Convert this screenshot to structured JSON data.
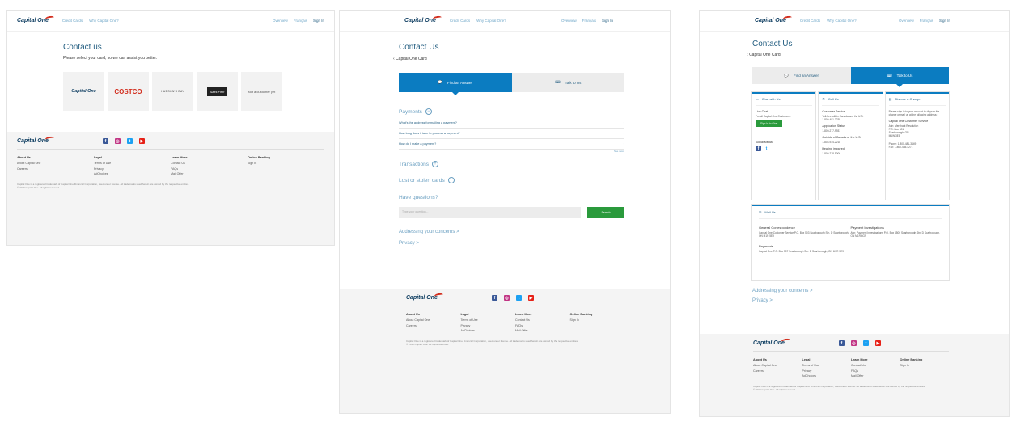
{
  "brand": {
    "logo_text": "Capital One",
    "accent": "#0b7cc1",
    "green": "#2a9a3c"
  },
  "header": {
    "nav": [
      "Credit Cards",
      "Why Capital One?"
    ],
    "right": [
      "Overview",
      "Français",
      "Sign In"
    ]
  },
  "screen1": {
    "title": "Contact us",
    "subtitle": "Please select your card, so we can assist you better.",
    "cards": [
      "Capital One",
      "COSTCO",
      "HUDSON'S BAY",
      "Saks Fifth",
      "Not a customer yet"
    ]
  },
  "screen2": {
    "title": "Contact Us",
    "back": "Capital One Card",
    "tabs": [
      "Find an Answer",
      "Talk to Us"
    ],
    "payments_heading": "Payments",
    "questions": [
      "What's the address for mailing a payment?",
      "How long does it take to process a payment?",
      "How do I make a payment?"
    ],
    "see_more": "See more",
    "transactions": "Transactions",
    "lost": "Lost or stolen cards",
    "have_questions": "Have questions?",
    "search_placeholder": "Type your question...",
    "search_button": "Search",
    "addressing": "Addressing your concerns >",
    "privacy": "Privacy >"
  },
  "screen3": {
    "title": "Contact Us",
    "back": "Capital One Card",
    "tabs": [
      "Find an Answer",
      "Talk to Us"
    ],
    "chat": {
      "head": "Chat with Us",
      "live": "Live Chat",
      "line1": "For all Capital One Customers:",
      "btn": "Sign In to Chat",
      "social": "Social Media"
    },
    "call": {
      "head": "Call Us",
      "cs": "Customer Service",
      "cs_sub": "Toll-free within Canada and the U.S.",
      "cs_num": "1-800-481-3239",
      "app": "Application Status",
      "app_num": "1-800-277-9931",
      "out": "Outside of Canada or the U.S.",
      "out_num": "1-804-934-2218",
      "hear": "Hearing impaired",
      "hear_num": "1-800-278-5006"
    },
    "dispute": {
      "head": "Dispute a Charge",
      "line": "Please sign in to your account to dispute the charge or mail us at the following address:",
      "org": "Capital One Customer Service",
      "addr": "Attn: Merchant Resolution",
      "po": "P.O. Box 501",
      "city": "Scarborough, ON",
      "code": "M1W 3E8",
      "phone": "Phone: 1-800-481-3449",
      "fax": "Fax: 1-800-435-4271"
    },
    "mail": {
      "head": "Mail Us",
      "gc": "General Correspondence",
      "gc_text": "Capital One Customer Service P.O. Box 503 Scarborough Stn. D Scarborough, ON M1R 5E9",
      "pi": "Payment Investigations",
      "pi_text": "Attn: Payment Investigations P.O. Box 4500 Scarborough Stn. D Scarborough, ON M1R 4G9",
      "pay": "Payments",
      "pay_text": "Capital One P.O. Box 507 Scarborough Stn. D Scarborough, ON M1R 5E9"
    },
    "addressing": "Addressing your concerns >",
    "privacy": "Privacy >"
  },
  "footer": {
    "cols": [
      {
        "h": "About Us",
        "items": [
          "About Capital One",
          "Careers"
        ]
      },
      {
        "h": "Legal",
        "items": [
          "Terms of Use",
          "Privacy",
          "AdChoices"
        ]
      },
      {
        "h": "Learn More",
        "items": [
          "Contact Us",
          "FAQs",
          "Mail Offer"
        ]
      },
      {
        "h": "Online Banking",
        "items": [
          "Sign In"
        ]
      }
    ],
    "legal": "Capital One is a registered trademark of Capital One Financial Corporation, used under license. All trademarks used herein are owned by the respective entities.",
    "copy": "© 2019 Capital One. All rights reserved."
  }
}
